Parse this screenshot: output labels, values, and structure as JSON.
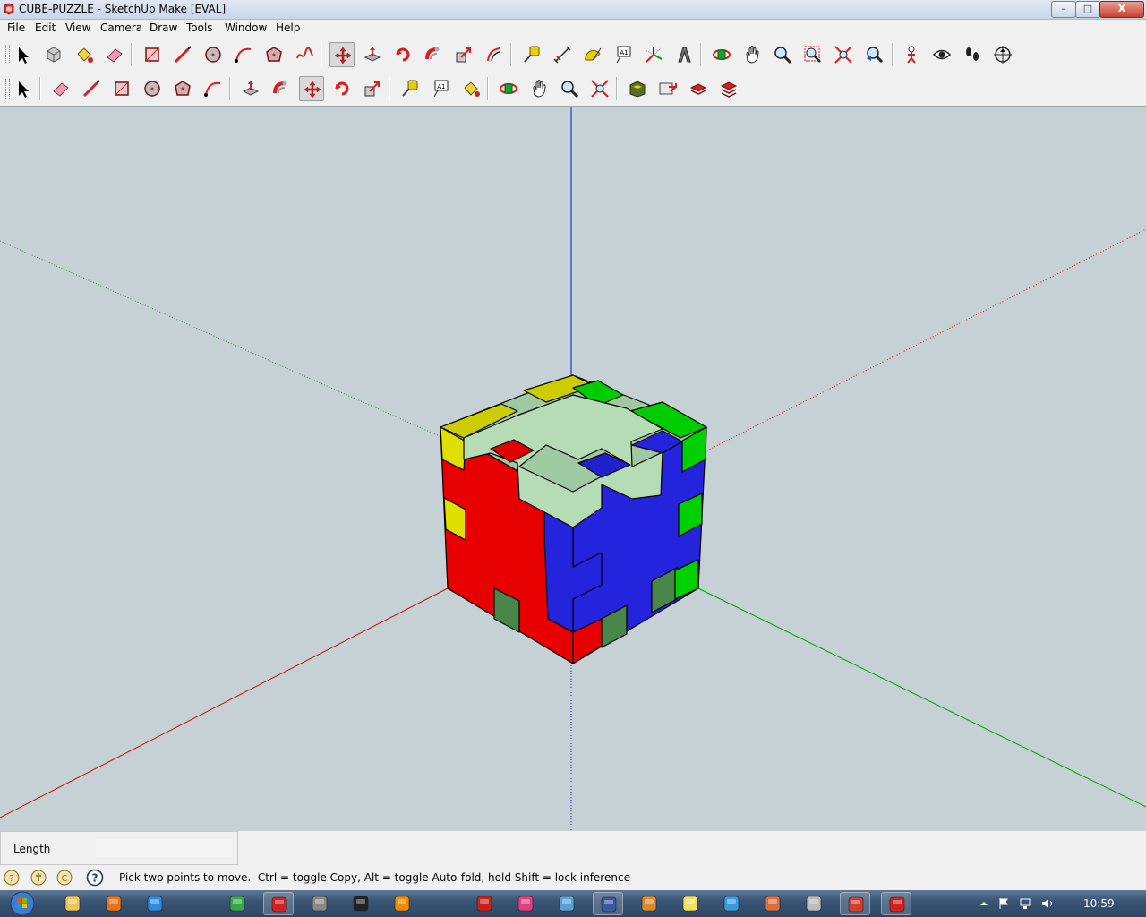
{
  "window": {
    "title": "CUBE-PUZZLE - SketchUp Make [EVAL]",
    "controls": [
      "–",
      "□",
      "X"
    ]
  },
  "menu": [
    "File",
    "Edit",
    "View",
    "Camera",
    "Draw",
    "Tools",
    "Window",
    "Help"
  ],
  "toolbar1": [
    "select-icon",
    "make-component-icon",
    "paint-bucket-icon",
    "eraser-icon",
    "rectangle-icon",
    "line-icon",
    "circle-icon",
    "arc-icon",
    "polygon-icon",
    "freehand-icon",
    "move-icon",
    "push-pull-icon",
    "rotate-icon",
    "follow-me-icon",
    "scale-icon",
    "offset-icon",
    "tape-measure-icon",
    "dimensions-icon",
    "protractor-icon",
    "text-icon",
    "axes-icon",
    "3d-text-icon",
    "orbit-icon",
    "pan-icon",
    "zoom-icon",
    "zoom-window-icon",
    "zoom-extents-icon",
    "previous-view-icon",
    "position-camera-icon",
    "look-around-icon",
    "walk-icon",
    "section-plane-icon"
  ],
  "toolbar2": [
    "select-icon",
    "eraser-icon",
    "pencil-icon",
    "rectangle-icon",
    "circle-icon",
    "polygon-icon",
    "arc-icon",
    "push-pull-icon",
    "follow-me-icon",
    "move-icon",
    "rotate-icon",
    "scale-icon",
    "tape-measure-icon",
    "text-icon",
    "paint-bucket-icon",
    "orbit-icon",
    "pan-icon",
    "zoom-icon",
    "zoom-extents-icon",
    "3d-warehouse-icon",
    "share-model-icon",
    "get-components-icon",
    "extension-warehouse-icon"
  ],
  "active_tool": "move-icon",
  "viewport": {
    "background": "#c5d1d4",
    "colors": {
      "red": "#e00000",
      "blue": "#2222dd",
      "mint": "#9fc9a0",
      "green": "#00cc00",
      "yellow": "#dddd00",
      "darkgreen": "#4a8a4a"
    }
  },
  "measurements": {
    "label": "Length",
    "value": ""
  },
  "status": {
    "message": "Pick two points to move.  Ctrl = toggle Copy, Alt = toggle Auto-fold, hold Shift = lock inference"
  },
  "taskbar": {
    "clock": "10:59",
    "items": [
      "explorer-icon",
      "firefox-icon",
      "internet-explorer-icon",
      "chrome-icon",
      "sketchup-red-icon",
      "media-icon",
      "inkscape-icon",
      "vlc-icon",
      "acrobat-icon",
      "paint-icon",
      "people-icon",
      "floppy-icon",
      "film-icon",
      "notes-icon",
      "browser-icon",
      "fish-icon",
      "calculator-icon",
      "recorder-icon",
      "sketchup-icon"
    ]
  }
}
